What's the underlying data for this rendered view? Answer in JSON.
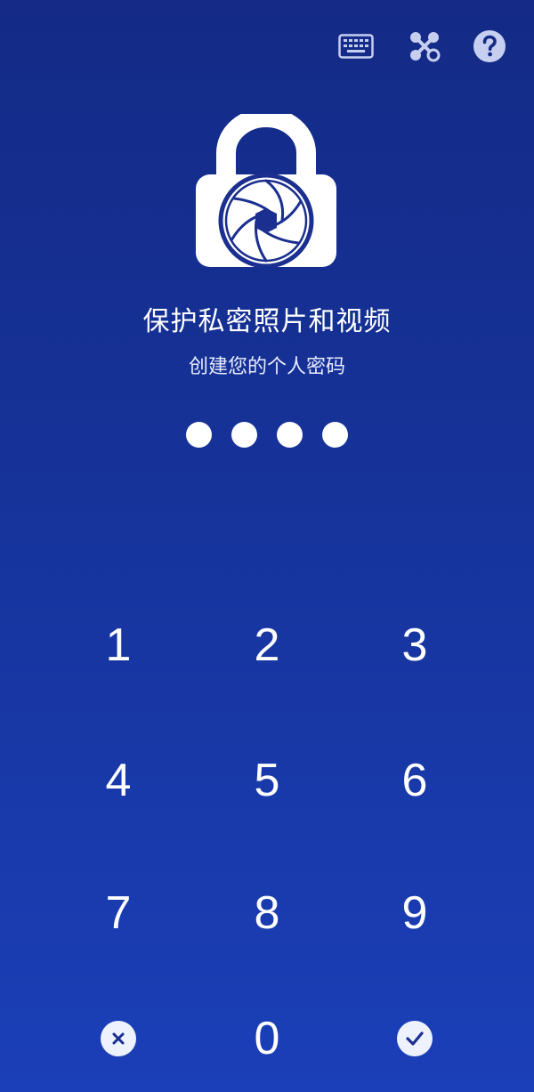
{
  "toolbar": {
    "keyboard_icon": "keyboard-icon",
    "pattern_icon": "pattern-lock-icon",
    "help_icon": "help-icon"
  },
  "logo_icon": "lock-shutter-icon",
  "title": "保护私密照片和视频",
  "subtitle": "创建您的个人密码",
  "pin": {
    "filled": 4,
    "length": 4
  },
  "keypad": {
    "keys": [
      "1",
      "2",
      "3",
      "4",
      "5",
      "6",
      "7",
      "8",
      "9",
      "0"
    ],
    "clear_icon": "clear-icon",
    "confirm_icon": "checkmark-icon"
  },
  "colors": {
    "background_top": "#142a86",
    "background_bottom": "#1b3fb8",
    "foreground": "#ffffff",
    "icon_ink": "#1a2f8f"
  }
}
